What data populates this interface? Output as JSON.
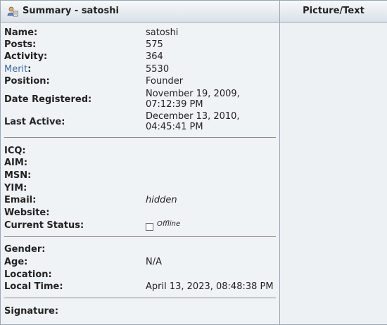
{
  "header": {
    "summary_title": "Summary - satoshi",
    "picture_title": "Picture/Text",
    "icon": "user-profile-icon"
  },
  "summary": {
    "name_label": "Name:",
    "name": "satoshi",
    "posts_label": "Posts:",
    "posts": "575",
    "activity_label": "Activity:",
    "activity": "364",
    "merit_label": "Merit",
    "merit_colon": ":",
    "merit": "5530",
    "position_label": "Position:",
    "position": "Founder",
    "registered_label": "Date Registered:",
    "registered_line1": "November 19, 2009,",
    "registered_line2": "07:12:39 PM",
    "last_active_label": "Last Active:",
    "last_active_line1": "December 13, 2010,",
    "last_active_line2": "04:45:41 PM"
  },
  "contact": {
    "icq_label": "ICQ:",
    "aim_label": "AIM:",
    "msn_label": "MSN:",
    "yim_label": "YIM:",
    "email_label": "Email:",
    "email": "hidden",
    "website_label": "Website:",
    "status_label": "Current Status:",
    "status": "Offline"
  },
  "personal": {
    "gender_label": "Gender:",
    "age_label": "Age:",
    "age": "N/A",
    "location_label": "Location:",
    "local_time_label": "Local Time:",
    "local_time": "April 13, 2023, 08:48:38 PM"
  },
  "signature": {
    "label": "Signature:"
  },
  "colors": {
    "merit_link": "#3f6a9a",
    "panel_bg": "#f0f3f6",
    "border": "#9aa7b5"
  }
}
